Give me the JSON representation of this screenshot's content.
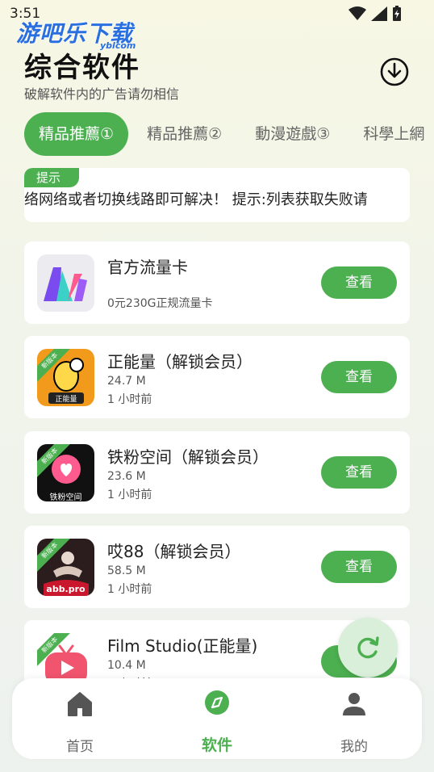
{
  "status": {
    "time": "3:51"
  },
  "watermark": {
    "text": "游吧乐下载",
    "sub": "yblcom"
  },
  "header": {
    "title": "综合软件",
    "subtitle": "破解软件内的广告请勿相信"
  },
  "tabs": [
    {
      "label": "精品推薦①"
    },
    {
      "label": "精品推薦②"
    },
    {
      "label": "動漫遊戲③"
    },
    {
      "label": "科學上網"
    }
  ],
  "notice": {
    "badge": "提示",
    "text": "络网络或者切换线路即可解决！    提示:列表获取失败请"
  },
  "apps": [
    {
      "name": "官方流量卡",
      "desc": "0元230G正规流量卡",
      "button": "查看"
    },
    {
      "name": "正能量（解锁会员）",
      "size": "24.7 M",
      "time": "1 小时前",
      "badge": "新版本",
      "icon_caption": "正能量",
      "button": "查看"
    },
    {
      "name": "铁粉空间（解锁会员）",
      "size": "23.6 M",
      "time": "1 小时前",
      "badge": "新版本",
      "icon_caption": "铁粉空间",
      "button": "查看"
    },
    {
      "name": "哎88（解锁会员）",
      "size": "58.5 M",
      "time": "1 小时前",
      "badge": "新版本",
      "icon_caption": "abb.pro",
      "button": "查看"
    },
    {
      "name": "Film Studio(正能量)",
      "size": "10.4 M",
      "time": "1 小时前",
      "badge": "新版本",
      "button": "查看"
    }
  ],
  "nav": {
    "items": [
      {
        "label": "首页",
        "icon": "home-icon"
      },
      {
        "label": "软件",
        "icon": "compass-icon"
      },
      {
        "label": "我的",
        "icon": "person-icon"
      }
    ]
  },
  "colors": {
    "accent": "#4caf50"
  }
}
